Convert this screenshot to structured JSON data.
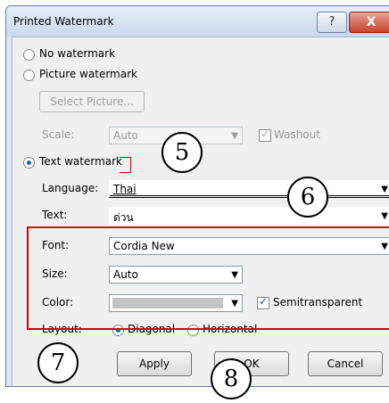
{
  "window": {
    "title": "Printed Watermark",
    "help": "?",
    "close": "X"
  },
  "options": {
    "no_watermark": "No watermark",
    "picture_watermark": "Picture watermark",
    "select_picture": "Select Picture...",
    "scale_label": "Scale:",
    "scale_value": "Auto",
    "washout_label": "Washout",
    "text_watermark": "Text watermark"
  },
  "text_wm": {
    "language_label": "Language:",
    "language_value": "Thai",
    "text_label": "Text:",
    "text_value": "ด่วน",
    "font_label": "Font:",
    "font_value": "Cordia New",
    "size_label": "Size:",
    "size_value": "Auto",
    "color_label": "Color:",
    "semitransparent_label": "Semitransparent",
    "layout_label": "Layout:",
    "diagonal_label": "Diagonal",
    "horizontal_label": "Horizontal"
  },
  "buttons": {
    "apply": "Apply",
    "ok": "OK",
    "cancel": "Cancel"
  },
  "callouts": {
    "c5": "5",
    "c6": "6",
    "c7": "7",
    "c8": "8"
  },
  "colors": {
    "highlight": "#e00000",
    "selected_radio": "#1f5fbf"
  }
}
